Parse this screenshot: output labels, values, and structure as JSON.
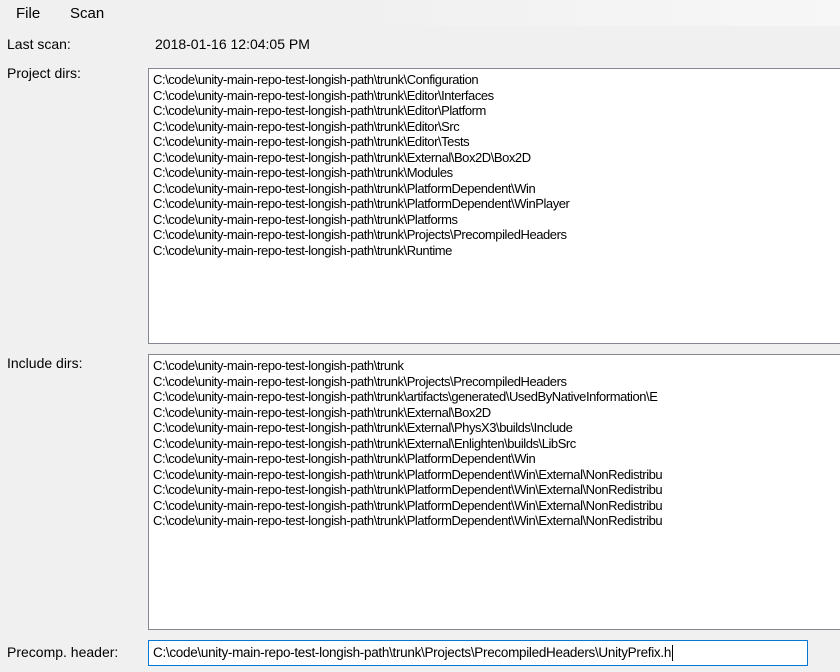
{
  "menu": {
    "file": "File",
    "scan": "Scan"
  },
  "last_scan": {
    "label": "Last scan:",
    "value": "2018-01-16 12:04:05 PM"
  },
  "project_dirs": {
    "label": "Project dirs:",
    "items": [
      "C:\\code\\unity-main-repo-test-longish-path\\trunk\\Configuration",
      "C:\\code\\unity-main-repo-test-longish-path\\trunk\\Editor\\Interfaces",
      "C:\\code\\unity-main-repo-test-longish-path\\trunk\\Editor\\Platform",
      "C:\\code\\unity-main-repo-test-longish-path\\trunk\\Editor\\Src",
      "C:\\code\\unity-main-repo-test-longish-path\\trunk\\Editor\\Tests",
      "C:\\code\\unity-main-repo-test-longish-path\\trunk\\External\\Box2D\\Box2D",
      "C:\\code\\unity-main-repo-test-longish-path\\trunk\\Modules",
      "C:\\code\\unity-main-repo-test-longish-path\\trunk\\PlatformDependent\\Win",
      "C:\\code\\unity-main-repo-test-longish-path\\trunk\\PlatformDependent\\WinPlayer",
      "C:\\code\\unity-main-repo-test-longish-path\\trunk\\Platforms",
      "C:\\code\\unity-main-repo-test-longish-path\\trunk\\Projects\\PrecompiledHeaders",
      "C:\\code\\unity-main-repo-test-longish-path\\trunk\\Runtime"
    ]
  },
  "include_dirs": {
    "label": "Include dirs:",
    "items": [
      "C:\\code\\unity-main-repo-test-longish-path\\trunk",
      "C:\\code\\unity-main-repo-test-longish-path\\trunk\\Projects\\PrecompiledHeaders",
      "C:\\code\\unity-main-repo-test-longish-path\\trunk\\artifacts\\generated\\UsedByNativeInformation\\E",
      "C:\\code\\unity-main-repo-test-longish-path\\trunk\\External\\Box2D",
      "C:\\code\\unity-main-repo-test-longish-path\\trunk\\External\\PhysX3\\builds\\Include",
      "C:\\code\\unity-main-repo-test-longish-path\\trunk\\External\\Enlighten\\builds\\LibSrc",
      "C:\\code\\unity-main-repo-test-longish-path\\trunk\\PlatformDependent\\Win",
      "C:\\code\\unity-main-repo-test-longish-path\\trunk\\PlatformDependent\\Win\\External\\NonRedistribu",
      "C:\\code\\unity-main-repo-test-longish-path\\trunk\\PlatformDependent\\Win\\External\\NonRedistribu",
      "C:\\code\\unity-main-repo-test-longish-path\\trunk\\PlatformDependent\\Win\\External\\NonRedistribu",
      "C:\\code\\unity-main-repo-test-longish-path\\trunk\\PlatformDependent\\Win\\External\\NonRedistribu"
    ]
  },
  "precomp_header": {
    "label": "Precomp. header:",
    "value": "C:\\code\\unity-main-repo-test-longish-path\\trunk\\Projects\\PrecompiledHeaders\\UnityPrefix.h"
  }
}
